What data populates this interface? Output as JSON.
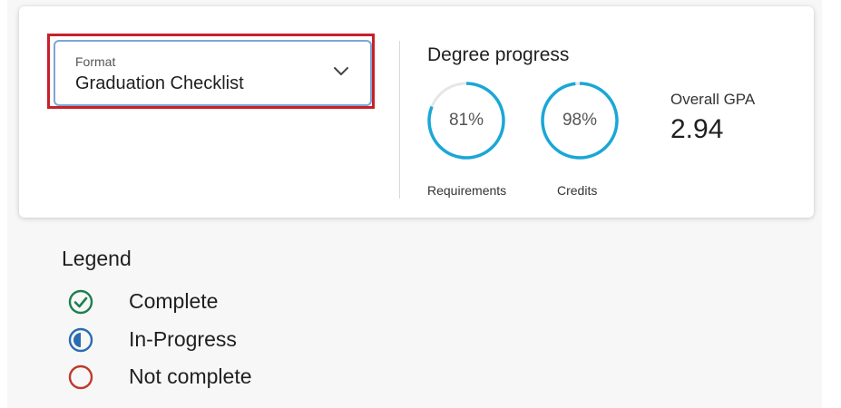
{
  "format": {
    "label": "Format",
    "value": "Graduation Checklist"
  },
  "degree_progress": {
    "title": "Degree progress",
    "requirements": {
      "percent_label": "81%",
      "fraction": 0.81,
      "caption": "Requirements"
    },
    "credits": {
      "percent_label": "98%",
      "fraction": 0.98,
      "caption": "Credits"
    }
  },
  "gpa": {
    "label": "Overall GPA",
    "value": "2.94"
  },
  "legend": {
    "title": "Legend",
    "items": [
      {
        "label": "Complete",
        "icon": "check-circle-icon",
        "color": "#1e7f4f"
      },
      {
        "label": "In-Progress",
        "icon": "half-circle-icon",
        "color": "#2b6cb0"
      },
      {
        "label": "Not complete",
        "icon": "empty-circle-icon",
        "color": "#c0392b"
      }
    ]
  },
  "colors": {
    "ring": "#1aa7d6",
    "highlight_border": "#c8202a",
    "select_border": "#7fa5d6"
  }
}
